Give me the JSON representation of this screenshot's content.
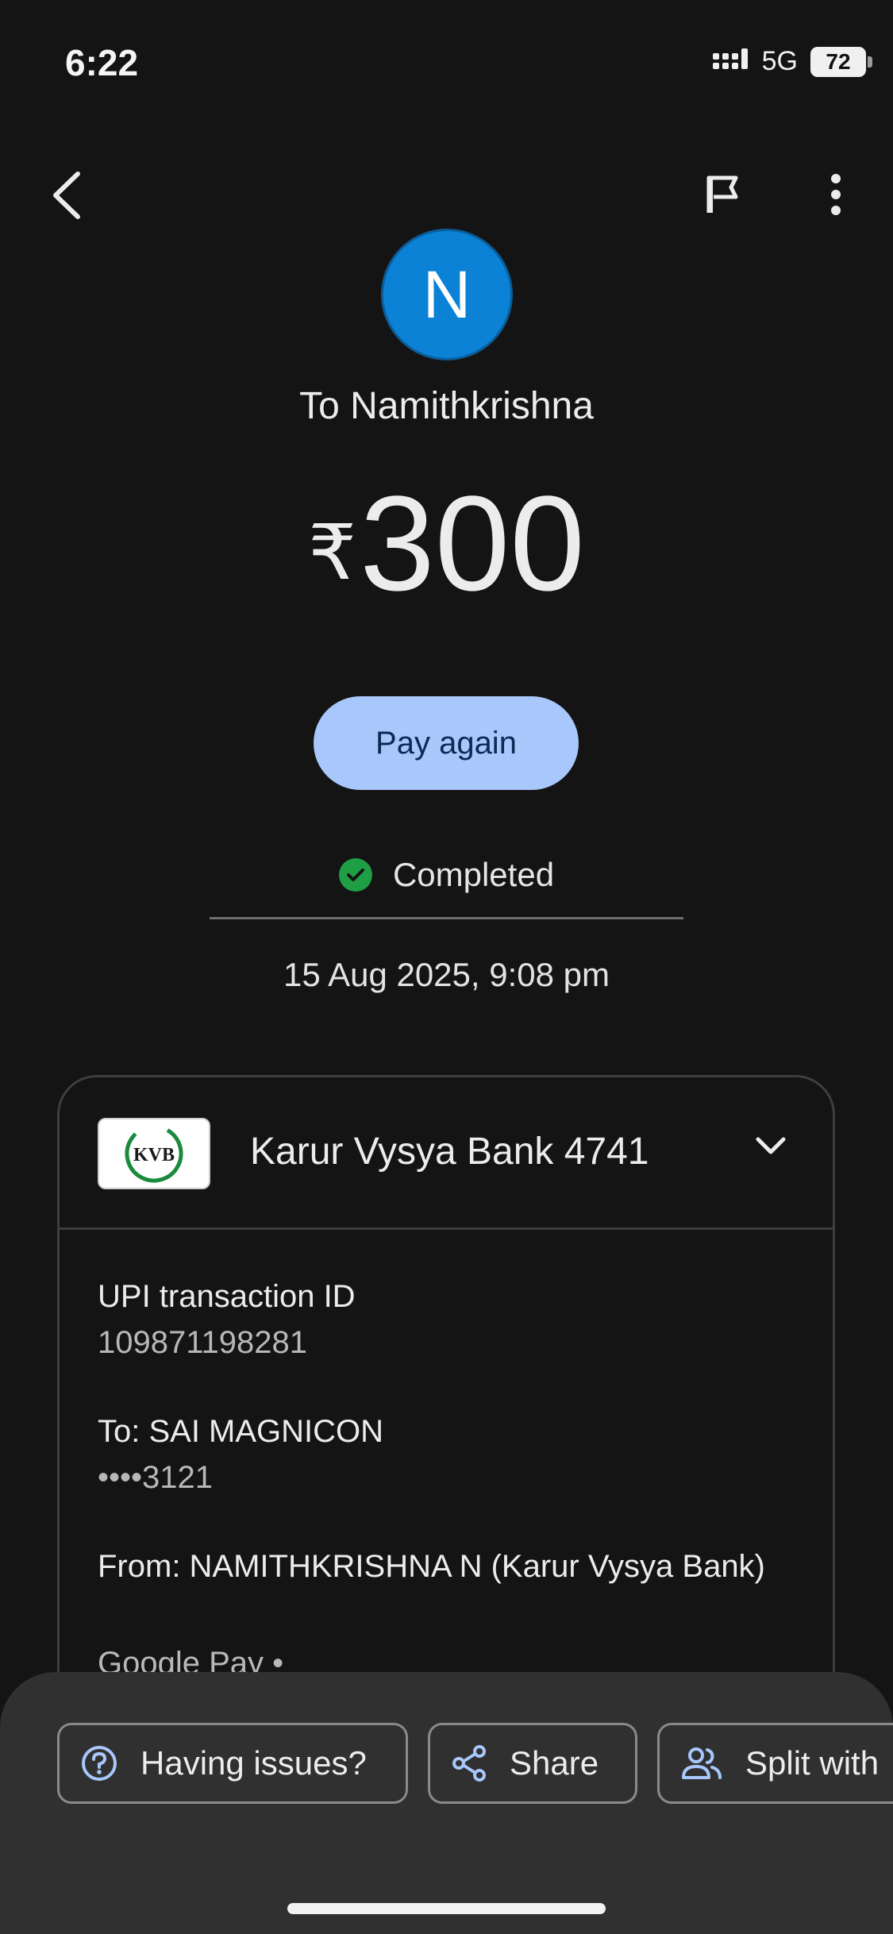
{
  "status_bar": {
    "time": "6:22",
    "network": "5G",
    "battery": "72"
  },
  "transaction": {
    "avatar_initial": "N",
    "recipient_line": "To Namithkrishna",
    "currency_symbol": "₹",
    "amount": "300",
    "pay_again_label": "Pay again",
    "status": "Completed",
    "datetime": "15 Aug 2025, 9:08 pm"
  },
  "card": {
    "bank_logo_text": "KVB",
    "bank_name": "Karur Vysya Bank 4741",
    "upi_id_label": "UPI transaction ID",
    "upi_id_value": "109871198281",
    "to_label": "To: SAI MAGNICON",
    "to_value": "••••3121",
    "from_label": "From: NAMITHKRISHNA N (Karur Vysya Bank)",
    "from_value": "Google Pay •"
  },
  "actions": {
    "issues_label": "Having issues?",
    "share_label": "Share",
    "split_label": "Split with"
  },
  "colors": {
    "background": "#141414",
    "accent": "#a8c7fa",
    "success": "#1e9e45",
    "avatar": "#0b82d6"
  },
  "icons": [
    "back-icon",
    "flag-icon",
    "more-vert-icon",
    "check-circle-icon",
    "chevron-down-icon",
    "help-circle-icon",
    "share-icon",
    "people-icon"
  ]
}
